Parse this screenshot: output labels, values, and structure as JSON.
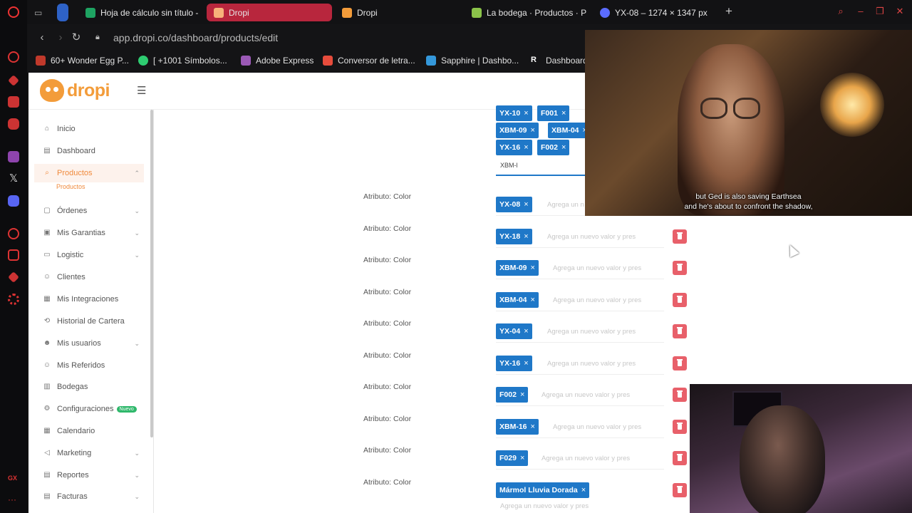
{
  "browser": {
    "tabs": [
      {
        "label": "Hoja de cálculo sin título -",
        "color": "#1ea362"
      },
      {
        "label": "Dropi",
        "color": "#f39c3a",
        "active": true
      },
      {
        "label": "Dropi",
        "color": "#f39c3a"
      },
      {
        "label": "La bodega · Productos · P",
        "color": "#8bc34a"
      },
      {
        "label": "YX-08 – 1274 × 1347 px",
        "color": "#5b6cff"
      }
    ],
    "url": "app.dropi.co/dashboard/products/edit",
    "bookmarks": [
      {
        "label": "60+ Wonder Egg P...",
        "color": "#c0392b"
      },
      {
        "label": "[ +1001 Símbolos...",
        "color": "#2ecc71"
      },
      {
        "label": "Adobe Express",
        "color": "#9b59b6"
      },
      {
        "label": "Conversor de letra...",
        "color": "#e74c3c"
      },
      {
        "label": "Sapphire | Dashbo...",
        "color": "#3498db"
      },
      {
        "label": "Dashboard",
        "color": "#222222"
      }
    ]
  },
  "app": {
    "logo": "dropi",
    "sidebar": {
      "items": [
        {
          "label": "Inicio",
          "icon": "home-icon"
        },
        {
          "label": "Dashboard",
          "icon": "dashboard-icon"
        },
        {
          "label": "Productos",
          "icon": "search-icon",
          "active": true
        },
        {
          "label": "Órdenes",
          "icon": "orders-icon"
        },
        {
          "label": "Mis Garantias",
          "icon": "warranty-icon"
        },
        {
          "label": "Logistic",
          "icon": "truck-icon"
        },
        {
          "label": "Clientes",
          "icon": "clients-icon"
        },
        {
          "label": "Mis Integraciones",
          "icon": "integrations-icon"
        },
        {
          "label": "Historial de Cartera",
          "icon": "history-icon"
        },
        {
          "label": "Mis usuarios",
          "icon": "users-icon"
        },
        {
          "label": "Mis Referidos",
          "icon": "referrals-icon"
        },
        {
          "label": "Bodegas",
          "icon": "warehouse-icon"
        },
        {
          "label": "Configuraciones",
          "icon": "settings-icon",
          "badge": "Nuevo"
        },
        {
          "label": "Calendario",
          "icon": "calendar-icon"
        },
        {
          "label": "Marketing",
          "icon": "marketing-icon"
        },
        {
          "label": "Reportes",
          "icon": "reports-icon"
        },
        {
          "label": "Facturas",
          "icon": "invoices-icon"
        }
      ],
      "sub_item": "Productos"
    },
    "top_tags": [
      "YX-10",
      "F001",
      "XBM-09",
      "XBM-04",
      "YX-16",
      "F002"
    ],
    "typing_value": "XBM-l",
    "attribute_label": "Atributo: Color",
    "placeholder": "Agrega un nuevo valor y pres",
    "placeholder_short": "Agrega un n",
    "rows": [
      {
        "tag": "YX-08"
      },
      {
        "tag": "YX-18"
      },
      {
        "tag": "XBM-09"
      },
      {
        "tag": "XBM-04"
      },
      {
        "tag": "YX-04"
      },
      {
        "tag": "YX-16"
      },
      {
        "tag": "F002"
      },
      {
        "tag": "XBM-16"
      },
      {
        "tag": "F029"
      },
      {
        "tag": "Mármol Lluvia Dorada"
      }
    ]
  },
  "overlay": {
    "caption_line1": "but Ged is also saving Earthsea",
    "caption_line2": "and he's about to confront the shadow,"
  }
}
